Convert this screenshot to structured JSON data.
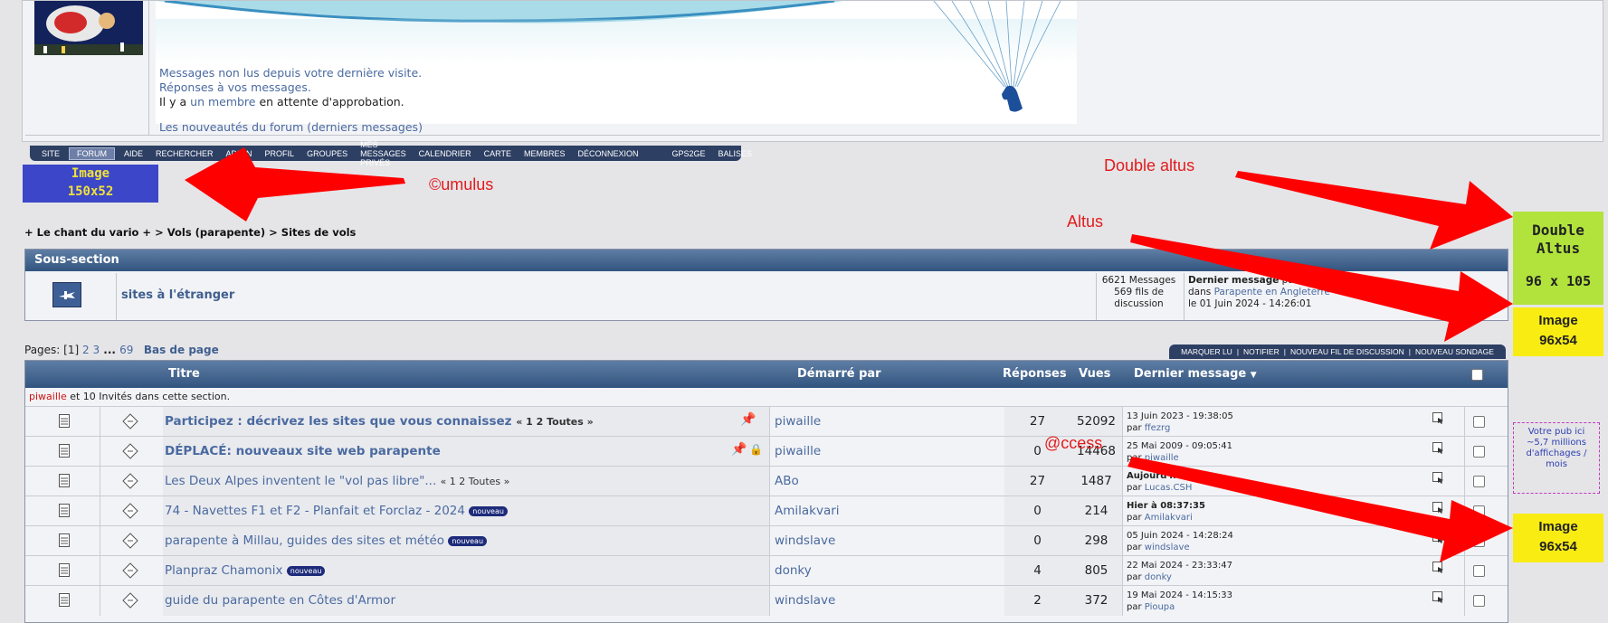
{
  "header": {
    "unread_link": "Messages non lus depuis votre dernière visite.",
    "replies_link": "Réponses à vos messages.",
    "approval_prefix": "Il y a ",
    "approval_link": "un membre",
    "approval_suffix": " en attente d'approbation.",
    "news_link": "Les nouveautés du forum (derniers messages)"
  },
  "nav": [
    "SITE",
    "FORUM",
    "AIDE",
    "RECHERCHER",
    "ADMIN",
    "PROFIL",
    "GROUPES",
    "MES MESSAGES PRIVÉS",
    "CALENDRIER",
    "CARTE",
    "MEMBRES",
    "DÉCONNEXION",
    "GPS2GE",
    "BALISES"
  ],
  "ads": {
    "left_image": [
      "Image",
      "150x52"
    ],
    "double_altus": [
      "Double",
      "Altus",
      "96 x 105"
    ],
    "image_96_a": [
      "Image",
      "96x54"
    ],
    "pub": [
      "Votre pub ici",
      "~5,7 millions",
      "d'affichages / mois"
    ],
    "image_96_b": [
      "Image",
      "96x54"
    ]
  },
  "annotations": {
    "cumulus": "©umulus",
    "double_altus": "Double altus",
    "altus": "Altus",
    "access": "@ccess"
  },
  "breadcrumb": {
    "item1": "+ Le chant du vario +",
    "sep": " > ",
    "item2": "Vols (parapente)",
    "item3": "Sites de vols"
  },
  "subsection": {
    "header": "Sous-section",
    "title": "sites à l'étranger",
    "messages": "6621 Messages",
    "threads": "569 fils de",
    "threads2": "discussion",
    "last_label": "Dernier message",
    "last_by": " par",
    "last_in": "dans ",
    "last_in_link": "Parapente en Angleterre",
    "last_date": "le 01 Juin 2024 - 14:26:01"
  },
  "pagination": {
    "label": "Pages: [",
    "current": "1",
    "close": "] ",
    "p2": "2",
    "p3": "3",
    "ellipsis": " ... ",
    "last": "69",
    "bottom": "Bas de page"
  },
  "toolbar": [
    "MARQUER LU",
    "NOTIFIER",
    "NOUVEAU FIL DE DISCUSSION",
    "NOUVEAU SONDAGE"
  ],
  "table": {
    "headers": {
      "title": "Titre",
      "started": "Démarré par",
      "replies": "Réponses",
      "views": "Vues",
      "last": "Dernier message"
    },
    "viewers_user": "piwaille",
    "viewers_rest": " et 10 Invités dans cette section.",
    "rows": [
      {
        "title": "Participez : décrivez les sites que vous connaissez",
        "bold": true,
        "pages": "« 1 2  Toutes »",
        "badge": "",
        "author": "piwaille",
        "replies": "27",
        "views": "52092",
        "last_date": "13 Juin 2023 - 19:38:05",
        "last_by": "ffezrg"
      },
      {
        "title": "DÉPLACÉ: nouveaux site web parapente",
        "bold": true,
        "pages": "",
        "badge": "",
        "author": "piwaille",
        "replies": "0",
        "views": "14468",
        "last_date": "25 Mai 2009 - 09:05:41",
        "last_by": "piwaille"
      },
      {
        "title": "Les Deux Alpes inventent le \"vol pas libre\"...",
        "bold": false,
        "pages": "« 1 2  Toutes »",
        "badge": "",
        "author": "ABo",
        "replies": "27",
        "views": "1487",
        "last_date": "Aujourd'hui à 15:",
        "last_by": "Lucas.CSH"
      },
      {
        "title": "74 - Navettes F1 et F2 - Planfait et Forclaz - 2024",
        "bold": false,
        "pages": "",
        "badge": "nouveau",
        "author": "Amilakvari",
        "replies": "0",
        "views": "214",
        "last_date": "Hier à 08:37:35",
        "last_by": "Amilakvari"
      },
      {
        "title": "parapente à Millau, guides des sites et météo",
        "bold": false,
        "pages": "",
        "badge": "nouveau",
        "author": "windslave",
        "replies": "0",
        "views": "298",
        "last_date": "05 Juin 2024 - 14:28:24",
        "last_by": "windslave"
      },
      {
        "title": "Planpraz Chamonix",
        "bold": false,
        "pages": "",
        "badge": "nouveau",
        "author": "donky",
        "replies": "4",
        "views": "805",
        "last_date": "22 Mai 2024 - 23:33:47",
        "last_by": "donky"
      },
      {
        "title": "guide du parapente en Côtes d'Armor",
        "bold": false,
        "pages": "",
        "badge": "",
        "author": "windslave",
        "replies": "2",
        "views": "372",
        "last_date": "19 Mai 2024 - 14:15:33",
        "last_by": "Pioupa"
      }
    ],
    "by_label": "par "
  },
  "colors": {
    "nav_bg": "#2d3f63",
    "header_grad_top": "#5f7ea4",
    "header_grad_bottom": "#31547f",
    "link": "#4a6aa0",
    "arrow": "#ff0000",
    "ad_green": "#b1e33c",
    "ad_yellow": "#f8ec13",
    "ad_blue": "#3c46c8"
  }
}
